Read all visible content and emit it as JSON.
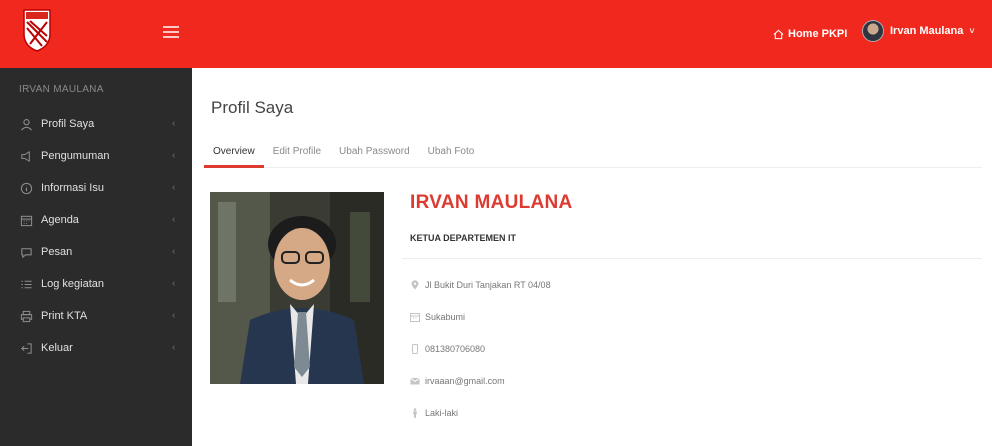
{
  "header": {
    "home_label": "Home PKPI",
    "user_label": "Irvan Maulana",
    "user_caret": "˅",
    "accent": "#f0281e"
  },
  "sidebar": {
    "user_name": "IRVAN MAULANA",
    "items": [
      {
        "label": "Profil Saya",
        "icon": "user-icon"
      },
      {
        "label": "Pengumuman",
        "icon": "megaphone-icon"
      },
      {
        "label": "Informasi Isu",
        "icon": "info-icon"
      },
      {
        "label": "Agenda",
        "icon": "calendar-icon"
      },
      {
        "label": "Pesan",
        "icon": "chat-icon"
      },
      {
        "label": "Log kegiatan",
        "icon": "list-icon"
      },
      {
        "label": "Print KTA",
        "icon": "printer-icon"
      },
      {
        "label": "Keluar",
        "icon": "logout-icon"
      }
    ],
    "arrow": "‹"
  },
  "main": {
    "title": "Profil Saya",
    "tabs": [
      {
        "label": "Overview",
        "active": true
      },
      {
        "label": "Edit Profile",
        "active": false
      },
      {
        "label": "Ubah Password",
        "active": false
      },
      {
        "label": "Ubah Foto",
        "active": false
      }
    ],
    "profile": {
      "name": "IRVAN MAULANA",
      "role": "KETUA DEPARTEMEN IT",
      "address": "Jl Bukit Duri Tanjakan RT 04/08",
      "city": "Sukabumi",
      "phone": "081380706080",
      "email": "irvaaan@gmail.com",
      "gender": "Laki-laki"
    },
    "name_color": "#dd3a30"
  }
}
